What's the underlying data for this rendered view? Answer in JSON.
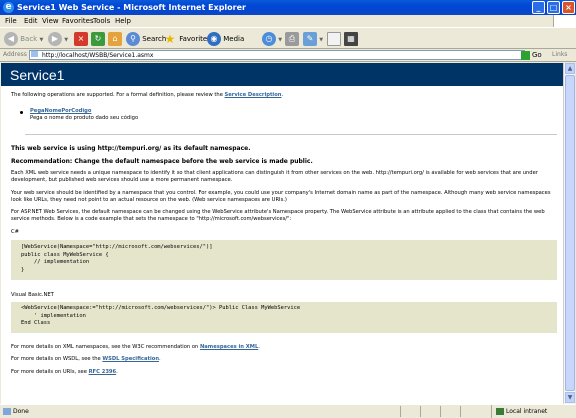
{
  "window": {
    "title": "Service1 Web Service - Microsoft Internet Explorer",
    "controls": {
      "minimize": "_",
      "maximize": "□",
      "close": "×"
    }
  },
  "menu": [
    "File",
    "Edit",
    "View",
    "Favorites",
    "Tools",
    "Help"
  ],
  "toolbar": {
    "back": "Back",
    "search": "Search",
    "favorites": "Favorites",
    "media": "Media"
  },
  "address": {
    "label": "Address",
    "url": "http://localhost/WSBB/Service1.asmx",
    "go": "Go",
    "links": "Links"
  },
  "page": {
    "heading": "Service1",
    "intro_text": "The following operations are supported. For a formal definition, please review the ",
    "intro_link": "Service Description",
    "intro_end": ".",
    "operation": {
      "name": "PegaNomePorCodigo",
      "description": "Pega o nome do produto dado seu código"
    },
    "namespace_warning": "This web service is using http://tempuri.org/ as its default namespace.",
    "recommendation": "Recommendation: Change the default namespace before the web service is made public.",
    "para1": "Each XML web service needs a unique namespace to identify it so that client applications can distinguish it from other services on the web. http://tempuri.org/ is available for web services that are under development, but published web services should use a more permanent namespace.",
    "para2": "Your web service should be identified by a namespace that you control. For example, you could use your company's Internet domain name as part of the namespace. Although many web service namespaces look like URLs, they need not point to an actual resource on the web. (Web service namespaces are URIs.)",
    "para3": "For ASP.NET Web Services, the default namespace can be changed using the WebService attribute's Namespace property. The WebService attribute is an attribute applied to the class that contains the web service methods. Below is a code example that sets the namespace to \"http://microsoft.com/webservices/\":",
    "csharp_label": "C#",
    "csharp_code": [
      "[WebService(Namespace=\"http://microsoft.com/webservices/\")]",
      "public class MyWebService {",
      "    // implementation",
      "}"
    ],
    "vb_label": "Visual Basic.NET",
    "vb_code": [
      "<WebService(Namespace:=\"http://microsoft.com/webservices/\")> Public Class MyWebService",
      "    ' implementation",
      "End Class"
    ],
    "xml_text": "For more details on XML namespaces, see the W3C recommendation on ",
    "xml_link": "Namespaces in XML",
    "wsdl_text": "For more details on WSDL, see the ",
    "wsdl_link": "WSDL Specification",
    "uri_text": "For more details on URIs, see ",
    "uri_link": "RFC 2396",
    "period": "."
  },
  "status": {
    "text": "Done",
    "zone": "Local intranet"
  }
}
